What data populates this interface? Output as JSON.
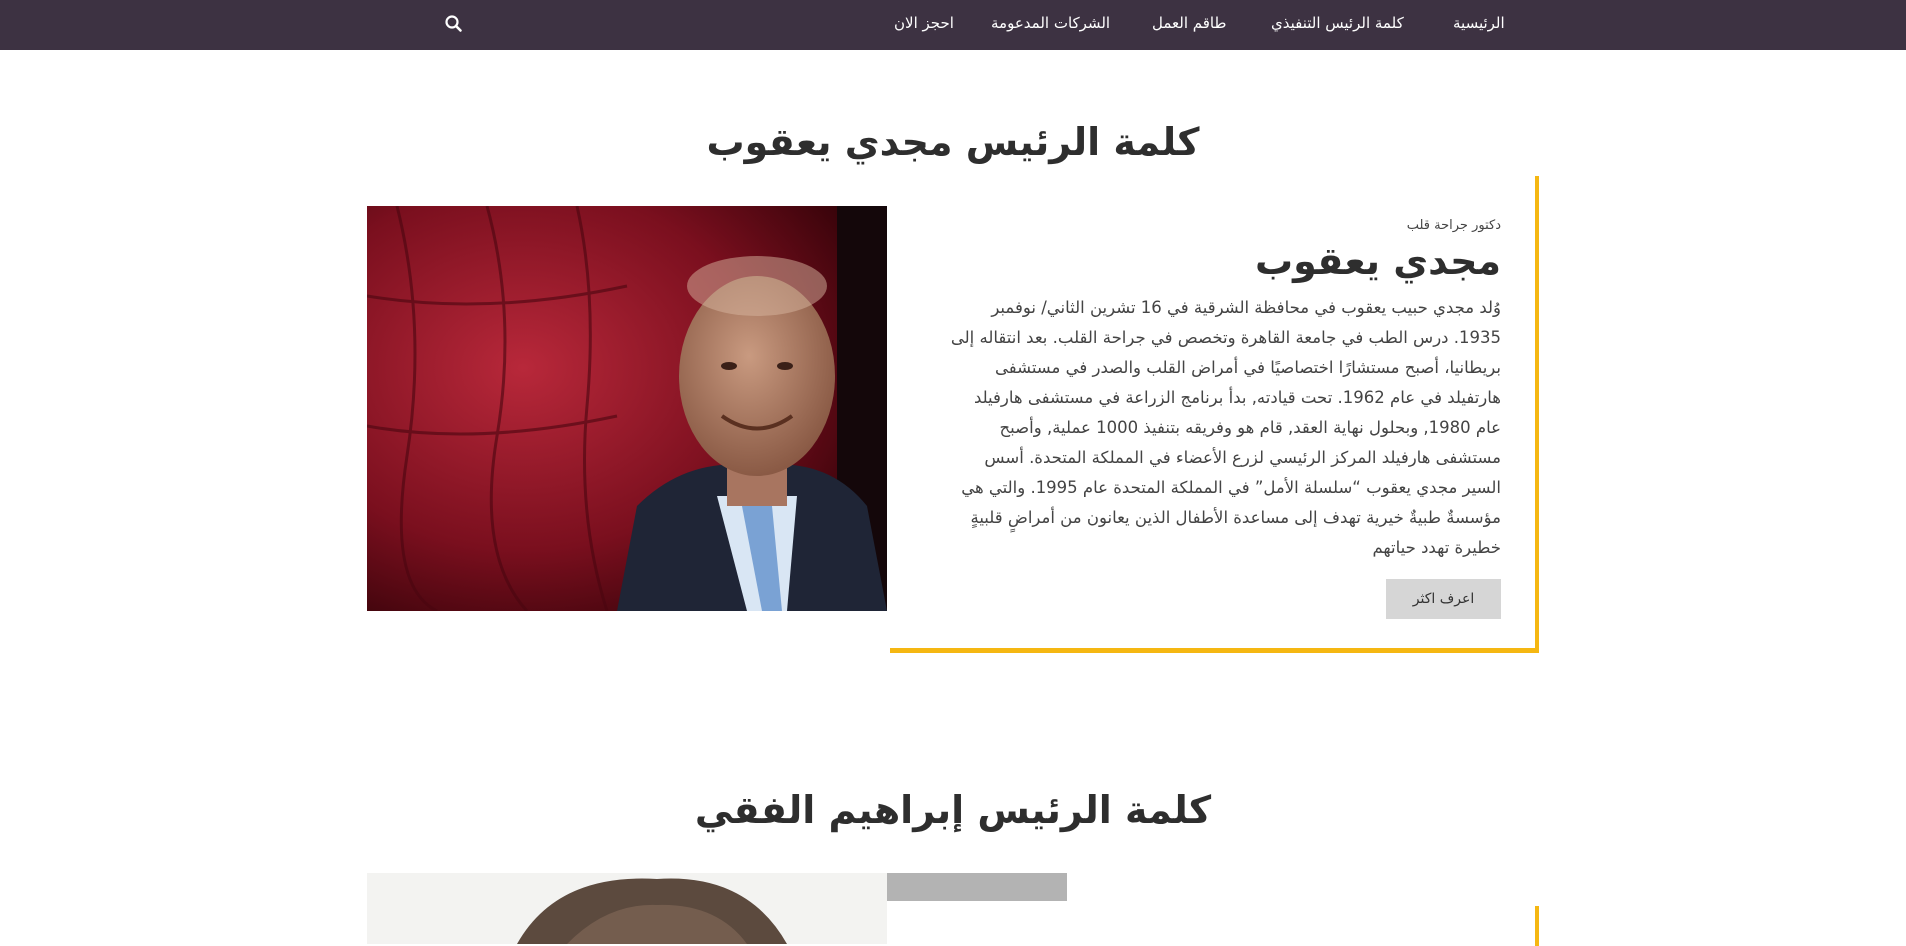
{
  "nav": {
    "items": [
      {
        "label": "الرئيسية"
      },
      {
        "label": "كلمة الرئيس التنفيذي"
      },
      {
        "label": "طاقم العمل"
      },
      {
        "label": "الشركات المدعومة"
      },
      {
        "label": "احجز الان"
      }
    ],
    "search_icon": "search-icon"
  },
  "colors": {
    "navbar": "#3d3242",
    "accent": "#f5b712",
    "button": "#d6d6d6"
  },
  "section1": {
    "title": "كلمة الرئيس مجدي يعقوب",
    "subtitle": "دكتور جراحة قلب",
    "name": "مجدي يعقوب",
    "bio": "وُلد مجدي حبيب يعقوب في محافظة الشرقية في 16 تشرين الثاني/ نوفمبر 1935. درس الطب في جامعة القاهرة وتخصص في جراحة القلب. بعد انتقاله إلى بريطانيا، أصبح مستشارًا اختصاصيًا في أمراض القلب والصدر في مستشفى هارتفيلد في عام 1962. تحت قيادته, بدأ برنامج الزراعة في مستشفى هارفيلد عام 1980, وبحلول نهاية العقد, قام هو وفريقه بتنفيذ 1000 عملية, وأصبح مستشفى هارفيلد المركز الرئيسي لزرع الأعضاء في المملكة المتحدة. أسس السير مجدي يعقوب “سلسلة الأمل” في المملكة المتحدة عام 1995. والتي هي مؤسسةٌ طبيةٌ خيرية تهدف إلى مساعدة الأطفال الذين يعانون من أمراضٍ قلبيةٍ خطيرة تهدد حياتهم",
    "button_label": "اعرف اكثر"
  },
  "section2": {
    "title": "كلمة الرئيس إبراهيم الفقي"
  }
}
